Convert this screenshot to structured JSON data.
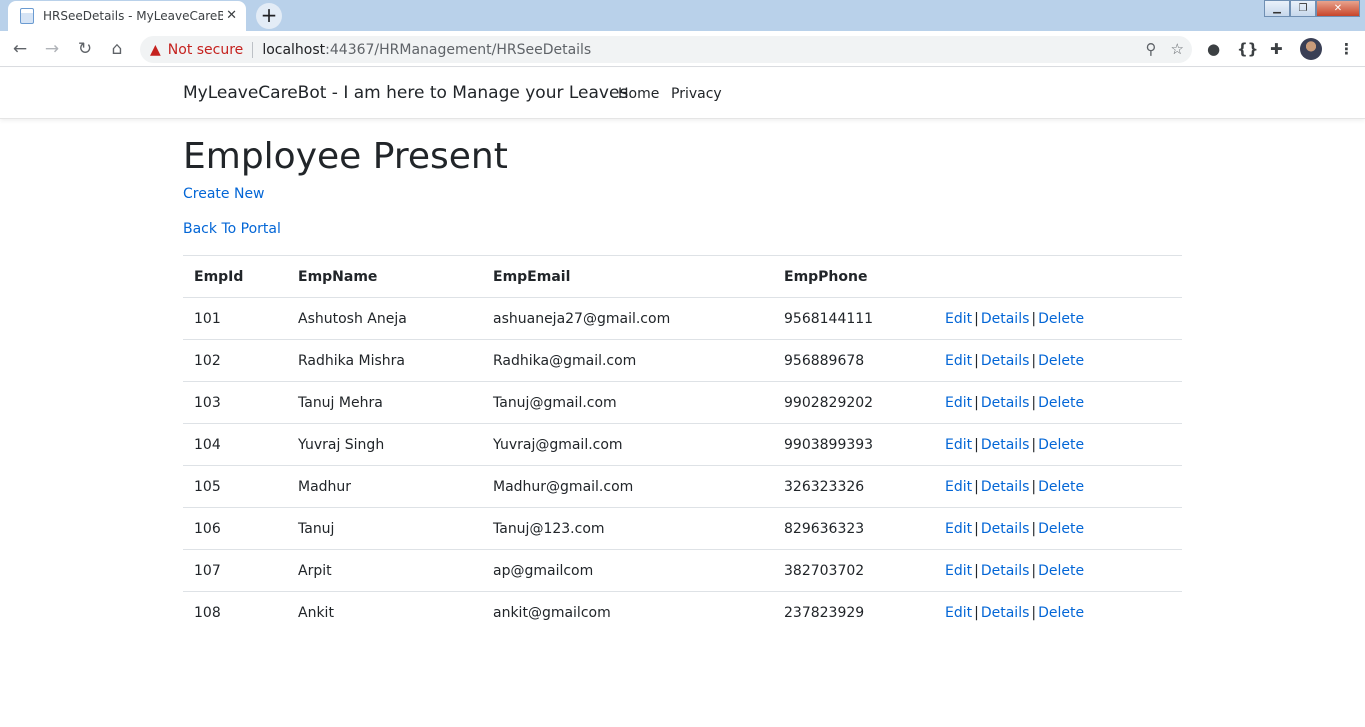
{
  "browser": {
    "tab_title": "HRSeeDetails - MyLeaveCareBot",
    "tab_close": "✕",
    "new_tab": "+",
    "security_label": "Not secure",
    "url_host": "localhost",
    "url_rest": ":44367/HRManagement/HRSeeDetails"
  },
  "site": {
    "brand": "MyLeaveCareBot - I am here to Manage your Leaves",
    "nav": [
      "Home",
      "Privacy"
    ]
  },
  "page": {
    "title": "Employee Present",
    "create_link": "Create New",
    "back_link": "Back To Portal"
  },
  "table": {
    "headers": [
      "EmpId",
      "EmpName",
      "EmpEmail",
      "EmpPhone"
    ],
    "action_labels": {
      "edit": "Edit",
      "details": "Details",
      "delete": "Delete",
      "separator": "|"
    },
    "rows": [
      {
        "id": "101",
        "name": "Ashutosh Aneja",
        "email": "ashuaneja27@gmail.com",
        "phone": "9568144111"
      },
      {
        "id": "102",
        "name": "Radhika Mishra",
        "email": "Radhika@gmail.com",
        "phone": "956889678"
      },
      {
        "id": "103",
        "name": "Tanuj Mehra",
        "email": "Tanuj@gmail.com",
        "phone": "9902829202"
      },
      {
        "id": "104",
        "name": "Yuvraj Singh",
        "email": "Yuvraj@gmail.com",
        "phone": "9903899393"
      },
      {
        "id": "105",
        "name": "Madhur",
        "email": "Madhur@gmail.com",
        "phone": "326323326"
      },
      {
        "id": "106",
        "name": "Tanuj",
        "email": "Tanuj@123.com",
        "phone": "829636323"
      },
      {
        "id": "107",
        "name": "Arpit",
        "email": "ap@gmailcom",
        "phone": "382703702"
      },
      {
        "id": "108",
        "name": "Ankit",
        "email": "ankit@gmailcom",
        "phone": "237823929"
      }
    ]
  },
  "colors": {
    "link": "#0366d6",
    "text": "#212529",
    "warning": "#c5221f",
    "titlebar": "#b9d1ea"
  },
  "icons": [
    "page-icon",
    "back-arrow-icon",
    "forward-arrow-icon",
    "reload-icon",
    "home-icon",
    "warning-icon",
    "zoom-icon",
    "star-icon",
    "extension-circle-icon",
    "braces-icon",
    "puzzle-icon",
    "avatar",
    "kebab-menu-icon"
  ]
}
